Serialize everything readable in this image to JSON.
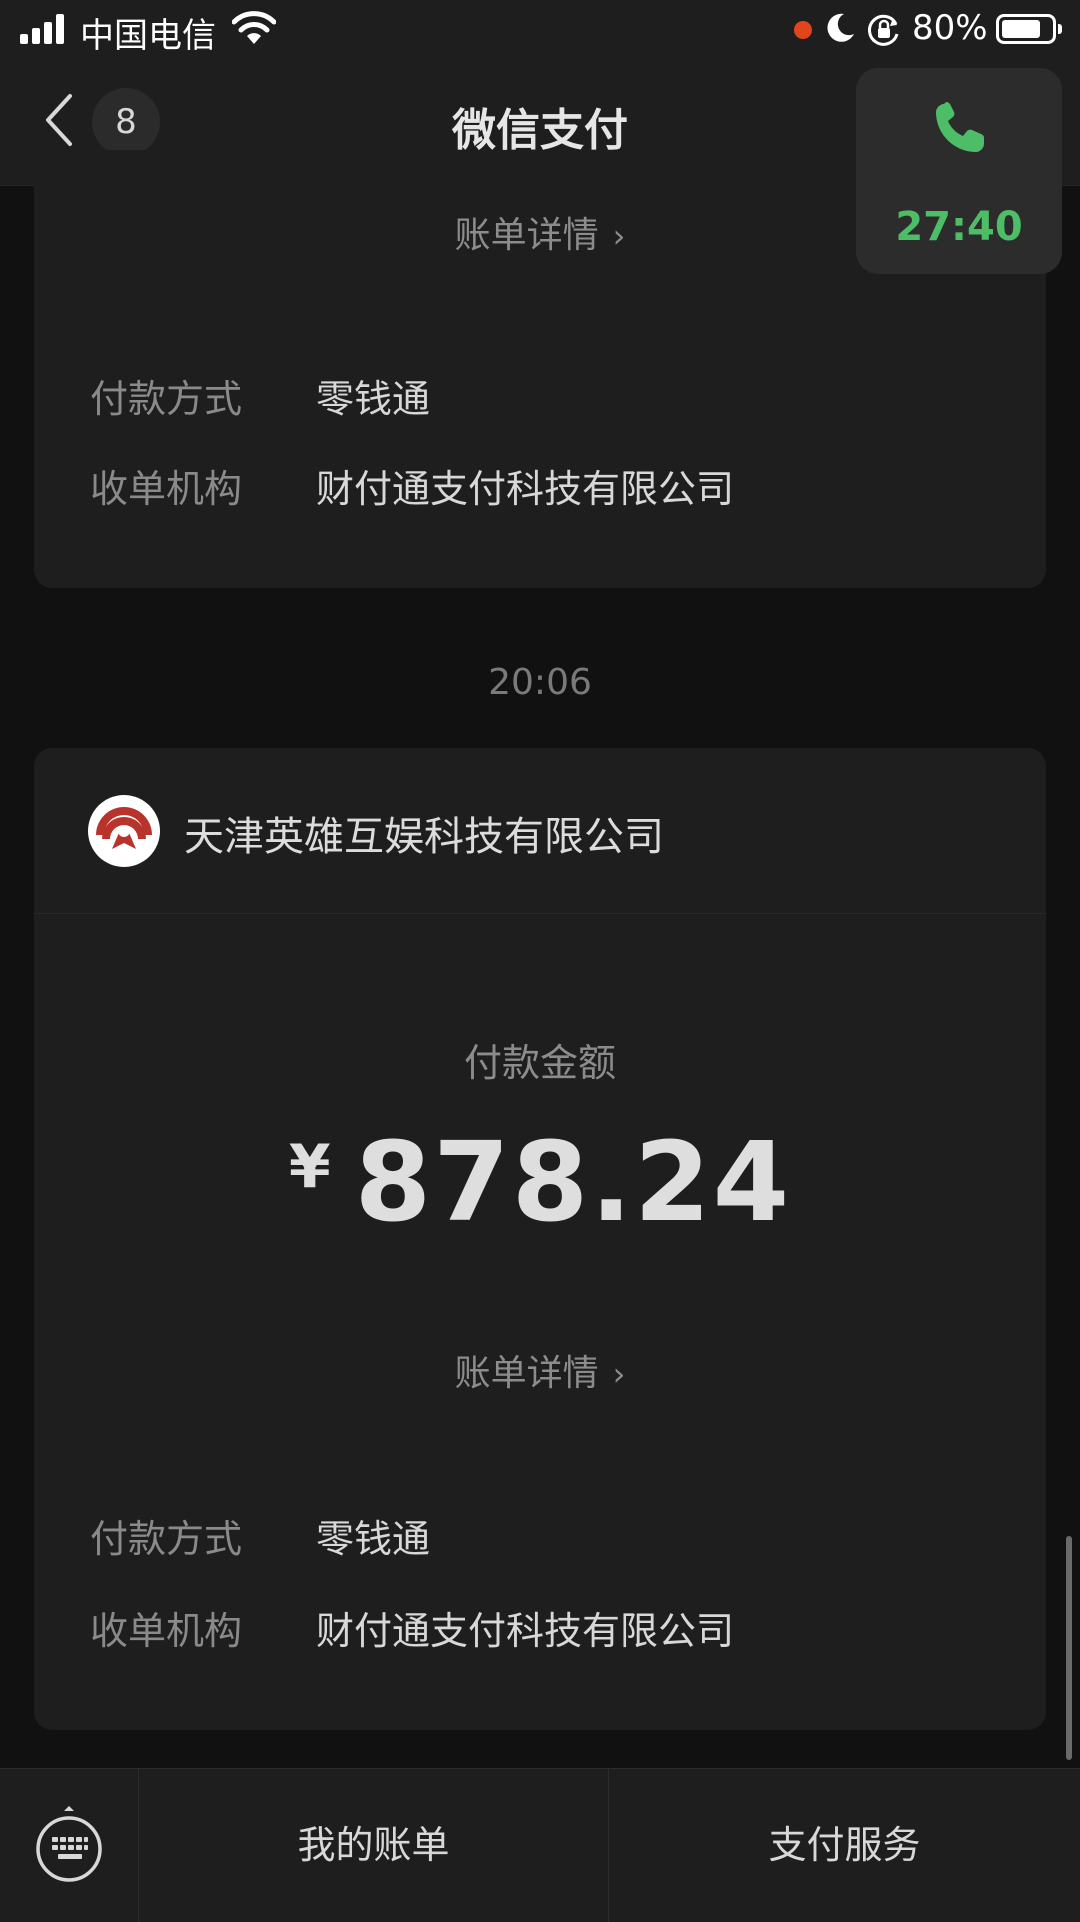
{
  "status_bar": {
    "carrier": "中国电信",
    "battery_percent": "80%",
    "battery_level": 0.8,
    "recording_dot_color": "#e0451c",
    "icons": [
      "signal-icon",
      "wifi-icon",
      "moon-icon",
      "rotation-lock-icon",
      "battery-icon"
    ]
  },
  "nav": {
    "title": "微信支付",
    "unread_count": "8",
    "back_icon": "chevron-left-icon"
  },
  "call_widget": {
    "duration": "27:40",
    "icon": "phone-icon",
    "color": "#4ebd68"
  },
  "card1": {
    "detail_link": "账单详情",
    "rows": [
      {
        "label": "付款方式",
        "value": "零钱通"
      },
      {
        "label": "收单机构",
        "value": "财付通支付科技有限公司"
      }
    ]
  },
  "timestamp": "20:06",
  "card2": {
    "merchant_name": "天津英雄互娱科技有限公司",
    "amount_label": "付款金额",
    "currency": "¥",
    "amount": "878.24",
    "detail_link": "账单详情",
    "rows": [
      {
        "label": "付款方式",
        "value": "零钱通"
      },
      {
        "label": "收单机构",
        "value": "财付通支付科技有限公司"
      }
    ]
  },
  "bottom_menu": {
    "items": [
      "我的账单",
      "支付服务"
    ],
    "keyboard_icon": "keyboard-icon"
  }
}
